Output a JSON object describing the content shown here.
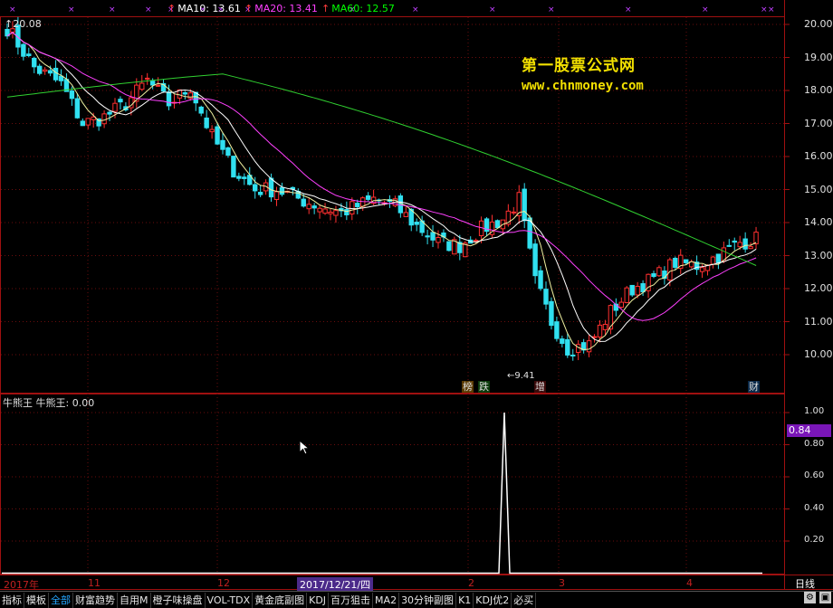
{
  "header": {
    "ma10": {
      "label": "MA10: 13.61",
      "color": "#ffffff"
    },
    "ma20": {
      "label": "MA20: 13.41",
      "color": "#ff40ff"
    },
    "ma60": {
      "label": "MA60: 12.57",
      "color": "#00ff00"
    },
    "arrow": "↑"
  },
  "price_panel": {
    "high_marker": "20.08",
    "low_marker": "9.41",
    "y_ticks": [
      "20.00",
      "19.00",
      "18.00",
      "17.00",
      "16.00",
      "15.00",
      "14.00",
      "13.00",
      "12.00",
      "11.00",
      "10.00"
    ],
    "signal_tags": [
      {
        "text": "榜",
        "color": "#e0c030"
      },
      {
        "text": "跌",
        "color": "#40e040"
      },
      {
        "text": "增",
        "color": "#ff5050"
      },
      {
        "text": "财",
        "color": "#a0d8ff"
      }
    ]
  },
  "watermark": {
    "title": "第一股票公式网",
    "url": "www.chnmoney.com"
  },
  "indicator_panel": {
    "title": "牛熊王  牛熊王: 0.00",
    "y_ticks": [
      "1.00",
      "0.80",
      "0.60",
      "0.40",
      "0.20"
    ],
    "cursor_value": "0.84"
  },
  "date_axis": {
    "labels": [
      {
        "text": "2017年"
      },
      {
        "text": "11"
      },
      {
        "text": "12"
      },
      {
        "text": "2017/12/21/四"
      },
      {
        "text": "2"
      },
      {
        "text": "3"
      },
      {
        "text": "4"
      }
    ],
    "period": "日线"
  },
  "tabs": [
    "指标",
    "模板",
    "全部",
    "财富趋势",
    "自用M",
    "橙子味操盘",
    "VOL-TDX",
    "黄金底副图",
    "KDJ",
    "百万狙击",
    "MA2",
    "30分钟副图",
    "K1",
    "KDJ优2",
    "必买"
  ],
  "active_tab": "全部",
  "chart_data": {
    "type": "candlestick",
    "title": "",
    "y_range_price": [
      9.4,
      20.2
    ],
    "series": [
      {
        "name": "MA10",
        "value": 13.61,
        "color": "#ffffff"
      },
      {
        "name": "MA20",
        "value": 13.41,
        "color": "#ff40ff"
      },
      {
        "name": "MA60",
        "value": 12.57,
        "color": "#00ff00"
      }
    ],
    "period_high": 20.08,
    "period_low": 9.41,
    "indicator": {
      "name": "牛熊王",
      "current": 0.0,
      "peak": 1.0,
      "y_range": [
        0,
        1.05
      ]
    }
  }
}
